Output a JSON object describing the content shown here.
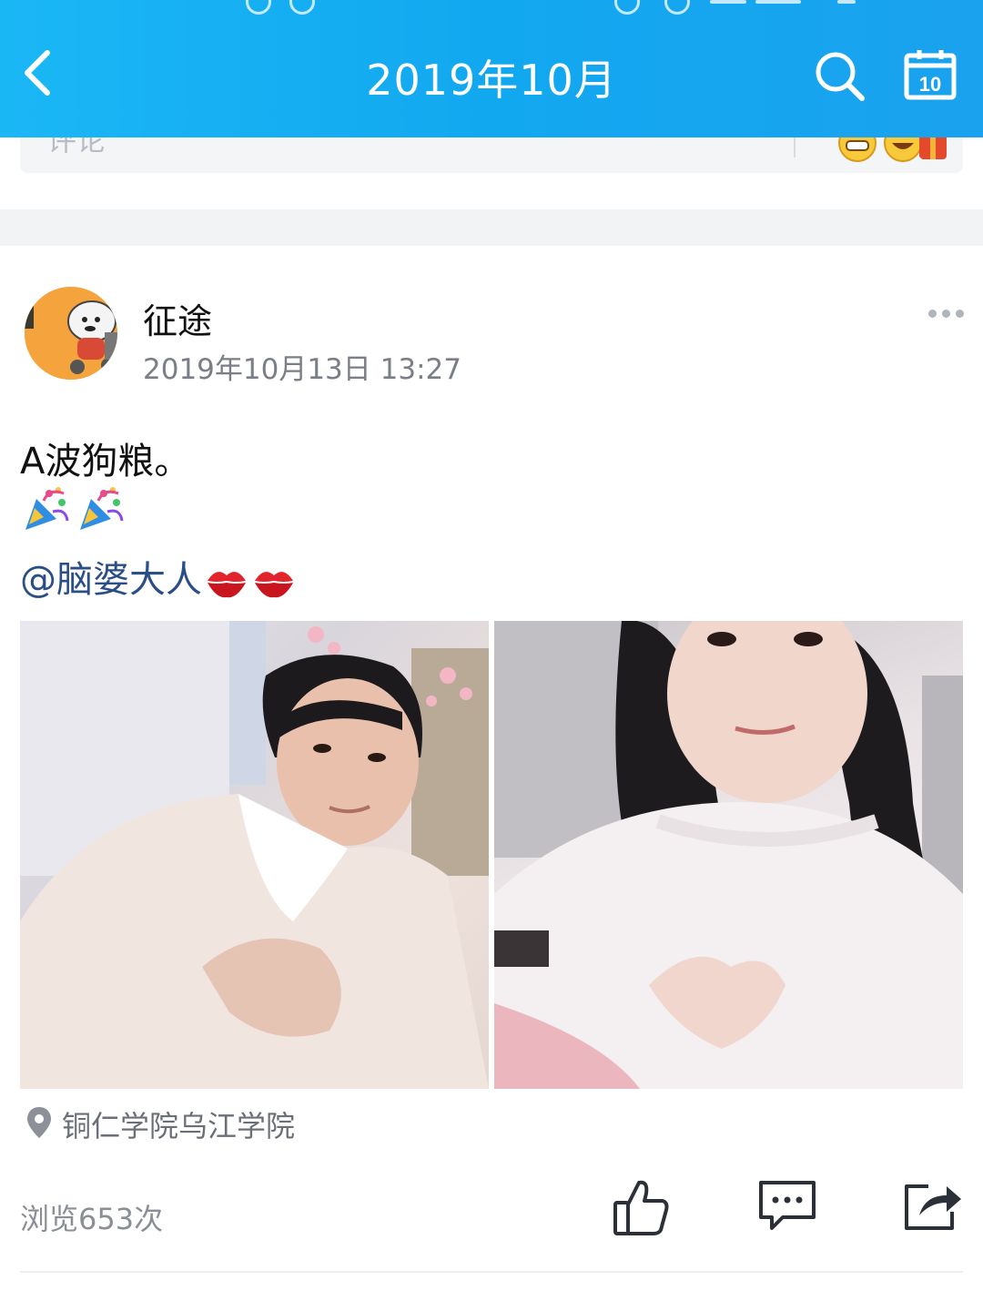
{
  "header": {
    "title": "2019年10月",
    "back_icon": "chevron-left-icon",
    "search_icon": "search-icon",
    "calendar_icon": "calendar-icon",
    "calendar_day": "10",
    "background": "#14acf1"
  },
  "previous_post": {
    "comment_placeholder": "评论"
  },
  "post": {
    "author": "征途",
    "timestamp": "2019年10月13日 13:27",
    "text_line": "A波狗粮。",
    "party_emojis": [
      "party-popper-icon",
      "party-popper-icon"
    ],
    "mention": "@脑婆大人",
    "kiss_emojis": [
      "kiss-icon",
      "kiss-icon"
    ],
    "photos": [
      "photo-boy-selfie",
      "photo-girl-selfie"
    ],
    "location": "铜仁学院乌江学院",
    "views": "浏览653次",
    "actions": [
      "like-icon",
      "comment-icon",
      "share-icon"
    ]
  }
}
